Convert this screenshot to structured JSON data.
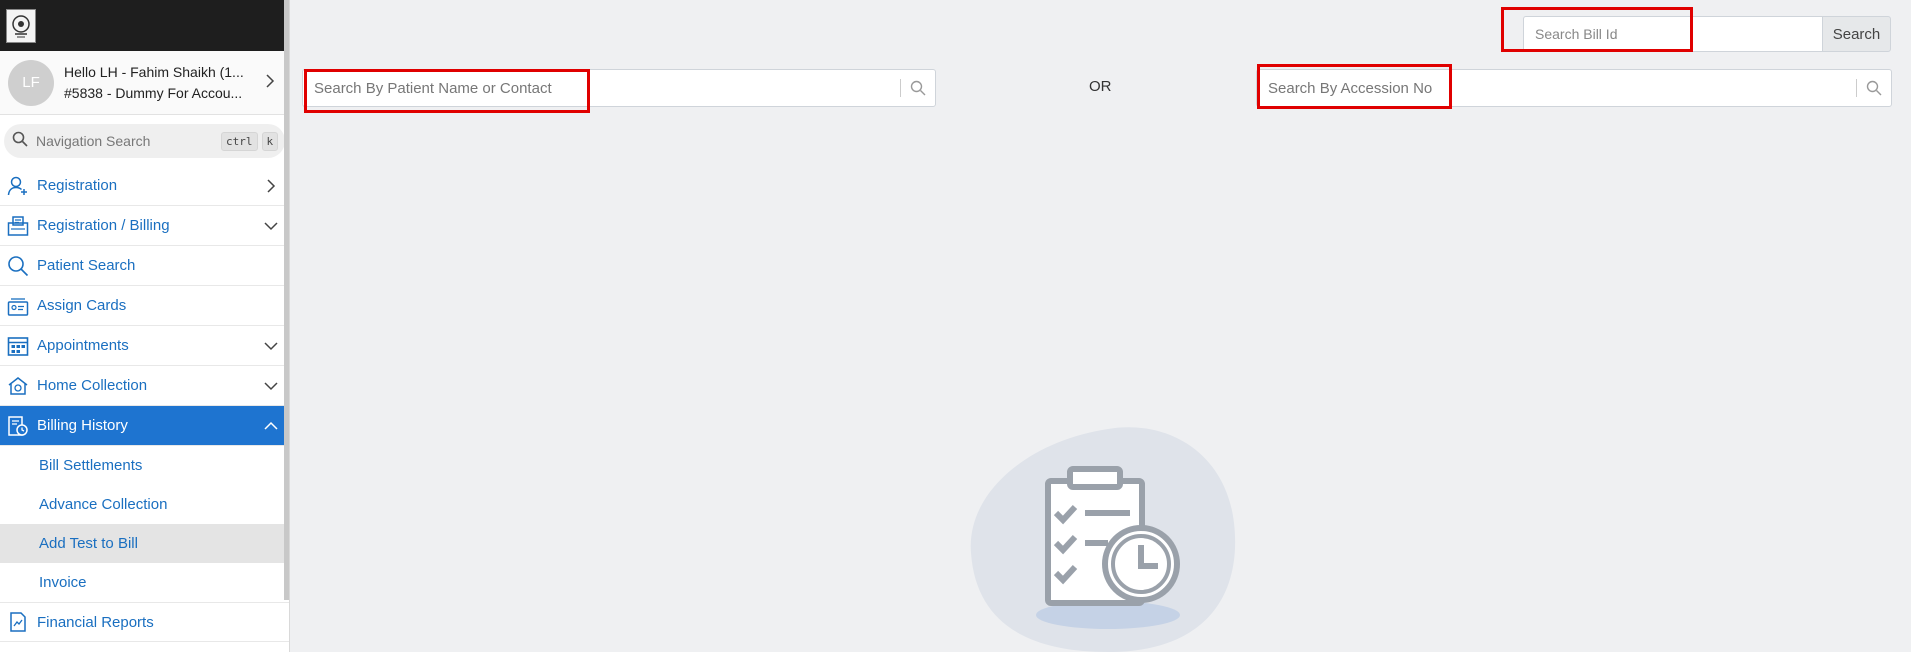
{
  "sidebar": {
    "user": {
      "avatar_initials": "LF",
      "greeting": "Hello LH - Fahim Shaikh (1...",
      "account": "#5838 - Dummy For Accou..."
    },
    "nav_search": {
      "placeholder": "Navigation Search",
      "shortcut_key1": "ctrl",
      "shortcut_key2": "k"
    },
    "items": [
      {
        "label": "Registration",
        "icon": "user-add-icon",
        "chevron": "right"
      },
      {
        "label": "Registration / Billing",
        "icon": "billing-icon",
        "chevron": "down"
      },
      {
        "label": "Patient Search",
        "icon": "search-icon",
        "chevron": "none"
      },
      {
        "label": "Assign Cards",
        "icon": "cards-icon",
        "chevron": "none"
      },
      {
        "label": "Appointments",
        "icon": "calendar-icon",
        "chevron": "down"
      },
      {
        "label": "Home Collection",
        "icon": "home-icon",
        "chevron": "down"
      },
      {
        "label": "Billing History",
        "icon": "history-icon",
        "chevron": "up",
        "active": true
      },
      {
        "label": "Financial Reports",
        "icon": "report-icon",
        "chevron": "none"
      }
    ],
    "sub_items": [
      {
        "label": "Bill Settlements"
      },
      {
        "label": "Advance Collection"
      },
      {
        "label": "Add Test to Bill",
        "selected": true
      },
      {
        "label": "Invoice"
      }
    ]
  },
  "main": {
    "bill_search": {
      "placeholder": "Search Bill Id",
      "button_label": "Search"
    },
    "patient_search": {
      "placeholder": "Search By Patient Name or Contact"
    },
    "or_label": "OR",
    "accession_search": {
      "placeholder": "Search By Accession No"
    }
  },
  "colors": {
    "accent": "#1e74d0",
    "highlight_border": "#e00000",
    "background": "#eff0f2"
  }
}
